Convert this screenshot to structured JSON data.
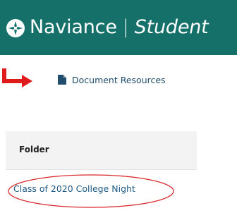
{
  "header": {
    "app_name": "Naviance",
    "separator": "|",
    "subtitle": "Student",
    "background_color": "#15706a",
    "logo_icon": "compass-star-icon"
  },
  "annotations": {
    "arrow_color": "#e01b1b",
    "ellipse_color": "#d9262a"
  },
  "main": {
    "document_resources_link": {
      "label": "Document Resources",
      "icon": "document-icon"
    },
    "table": {
      "column_header": "Folder",
      "rows": [
        {
          "folder": "Class of 2020 College Night"
        }
      ]
    }
  }
}
